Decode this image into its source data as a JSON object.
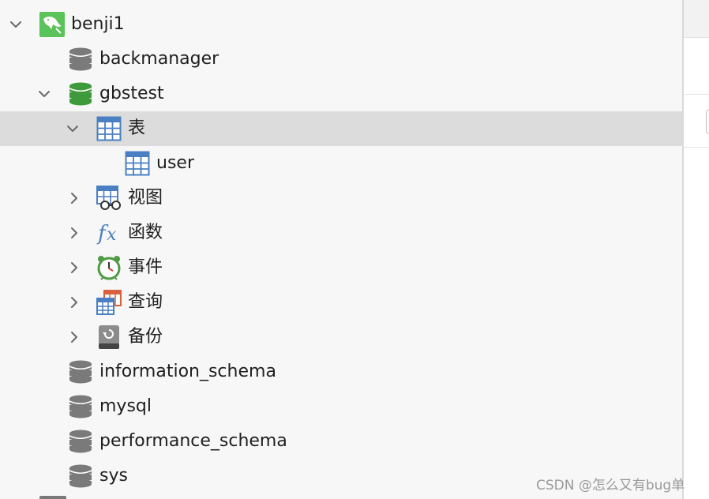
{
  "tree": {
    "connection": {
      "label": "benji1",
      "icon": "mysql-dolphin-icon",
      "expanded": true,
      "accent": "#5ac35a"
    },
    "databases": [
      {
        "label": "backmanager",
        "icon": "database-icon",
        "active": false
      },
      {
        "label": "gbstest",
        "icon": "database-icon",
        "active": true,
        "expanded": true,
        "children": [
          {
            "label": "表",
            "icon": "table-icon",
            "expanded": true,
            "selected": true,
            "children": [
              {
                "label": "user",
                "icon": "table-icon"
              }
            ]
          },
          {
            "label": "视图",
            "icon": "view-icon"
          },
          {
            "label": "函数",
            "icon": "function-fx-icon"
          },
          {
            "label": "事件",
            "icon": "clock-icon"
          },
          {
            "label": "查询",
            "icon": "query-icon"
          },
          {
            "label": "备份",
            "icon": "backup-icon"
          }
        ]
      },
      {
        "label": "information_schema",
        "icon": "database-icon",
        "active": false
      },
      {
        "label": "mysql",
        "icon": "database-icon",
        "active": false
      },
      {
        "label": "performance_schema",
        "icon": "database-icon",
        "active": false
      },
      {
        "label": "sys",
        "icon": "database-icon",
        "active": false
      }
    ]
  },
  "watermark": "CSDN @怎么又有bug单",
  "colors": {
    "selected_row": "#dcdcdc",
    "active_db": "#3e9a3a",
    "inactive_db": "#7a7a7a",
    "table_blue": "#4a7fc1"
  }
}
